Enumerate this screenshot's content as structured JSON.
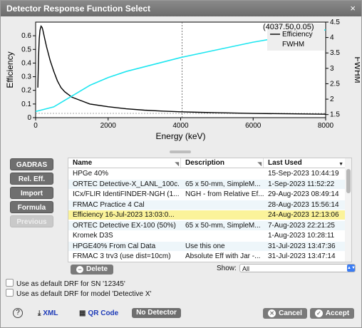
{
  "window": {
    "title": "Detector Response Function Select",
    "close_label": "×"
  },
  "chart_data": {
    "type": "line",
    "xlabel": "Energy (keV)",
    "ylabel": "Efficiency",
    "y2label": "FWHM",
    "xlim": [
      0,
      8000
    ],
    "ylim": [
      0,
      0.7
    ],
    "y2lim": [
      1.4,
      4.5
    ],
    "xticks": [
      0,
      2000,
      4000,
      6000,
      8000
    ],
    "yticks": [
      0,
      0.1,
      0.2,
      0.3,
      0.4,
      0.5,
      0.6
    ],
    "y2ticks": [
      1.5,
      2,
      2.5,
      3,
      3.5,
      4,
      4.5
    ],
    "cursor_readout": "(4037.50,0.05)",
    "cursor_x": 4037.5,
    "legend_position": "top-right",
    "series": [
      {
        "name": "Efficiency",
        "axis": "left",
        "color": "#000000",
        "points": [
          [
            60,
            0.22
          ],
          [
            80,
            0.45
          ],
          [
            100,
            0.58
          ],
          [
            120,
            0.64
          ],
          [
            150,
            0.67
          ],
          [
            180,
            0.66
          ],
          [
            200,
            0.64
          ],
          [
            250,
            0.58
          ],
          [
            300,
            0.52
          ],
          [
            350,
            0.47
          ],
          [
            400,
            0.42
          ],
          [
            500,
            0.34
          ],
          [
            600,
            0.27
          ],
          [
            700,
            0.22
          ],
          [
            800,
            0.19
          ],
          [
            1000,
            0.15
          ],
          [
            1200,
            0.13
          ],
          [
            1500,
            0.1
          ],
          [
            2000,
            0.08
          ],
          [
            2500,
            0.065
          ],
          [
            3000,
            0.055
          ],
          [
            3500,
            0.048
          ],
          [
            4000,
            0.043
          ],
          [
            4500,
            0.039
          ],
          [
            5000,
            0.036
          ],
          [
            6000,
            0.031
          ],
          [
            7000,
            0.028
          ],
          [
            8000,
            0.025
          ]
        ]
      },
      {
        "name": "FWHM",
        "axis": "right",
        "color": "#1ee6f0",
        "points": [
          [
            0,
            1.6
          ],
          [
            500,
            1.75
          ],
          [
            1000,
            2.1
          ],
          [
            1500,
            2.45
          ],
          [
            2000,
            2.7
          ],
          [
            2500,
            2.9
          ],
          [
            3000,
            3.05
          ],
          [
            3500,
            3.2
          ],
          [
            4000,
            3.35
          ],
          [
            5000,
            3.6
          ],
          [
            6000,
            3.85
          ],
          [
            7000,
            4.05
          ],
          [
            8000,
            4.25
          ]
        ]
      }
    ]
  },
  "sidebar": {
    "buttons": [
      {
        "label": "GADRAS"
      },
      {
        "label": "Rel. Eff."
      },
      {
        "label": "Import"
      },
      {
        "label": "Formula"
      },
      {
        "label": "Previous"
      }
    ]
  },
  "table": {
    "columns": [
      "Name",
      "Description",
      "Last Used"
    ],
    "rows": [
      {
        "name": "HPGe 40%",
        "description": "",
        "last_used": "15-Sep-2023 10:44:19"
      },
      {
        "name": "ORTEC Detective-X_LANL_100c...",
        "description": "65 x 50-mm, SimpleM...",
        "last_used": "1-Sep-2023 11:52:22"
      },
      {
        "name": "ICx/FLIR IdentiFINDER-NGH (1...",
        "description": "NGH - from Relative Ef...",
        "last_used": "29-Aug-2023 08:49:14"
      },
      {
        "name": "FRMAC Practice 4 Cal",
        "description": "",
        "last_used": "28-Aug-2023 15:56:14"
      },
      {
        "name": "Efficiency 16-Jul-2023 13:03:0...",
        "description": "",
        "last_used": "24-Aug-2023 12:13:06"
      },
      {
        "name": "ORTEC Detective EX-100 (50%)",
        "description": "65 x 50-mm, SimpleM...",
        "last_used": "7-Aug-2023 22:21:25"
      },
      {
        "name": "Kromek D3S",
        "description": "",
        "last_used": "1-Aug-2023 10:28:11"
      },
      {
        "name": "HPGE40% From Cal Data",
        "description": "Use this one",
        "last_used": "31-Jul-2023 13:47:36"
      },
      {
        "name": "FRMAC 3 trv3 (use dist=10cm)",
        "description": "Absolute Eff with Jar -...",
        "last_used": "31-Jul-2023 13:47:14"
      }
    ],
    "selected_index": 4
  },
  "controls": {
    "delete_label": "Delete",
    "show_label": "Show:",
    "show_value": "All",
    "default_sn_label": "Use as default DRF for SN '12345'",
    "default_model_label": "Use as default DRF for model 'Detective X'"
  },
  "footer": {
    "help_label": "?",
    "xml_label": "XML",
    "qr_label": "QR Code",
    "no_detector_label": "No Detector",
    "cancel_label": "Cancel",
    "accept_label": "Accept"
  }
}
